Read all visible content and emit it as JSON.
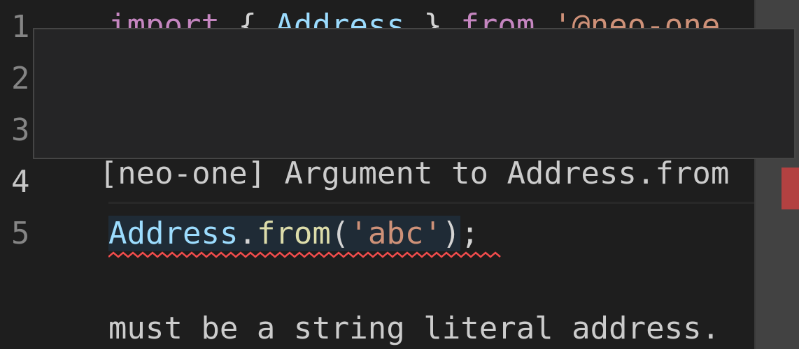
{
  "editor": {
    "line_numbers": [
      "1",
      "2",
      "3",
      "4",
      "5"
    ],
    "line1": {
      "kw_import": "import",
      "brace_open": " { ",
      "identifier": "Address",
      "brace_close": " } ",
      "kw_from": "from",
      "space": " ",
      "module": "'@neo-one"
    },
    "line5": {
      "object": "Address",
      "dot": ".",
      "method": "from",
      "paren_open": "(",
      "arg": "'abc'",
      "paren_close": ")",
      "semicolon": ";"
    }
  },
  "hover": {
    "line1": "[neo-one] Argument to Address.from",
    "line2": "must be a string literal address."
  },
  "colors": {
    "background": "#1e1e1e",
    "error": "#f14c4c",
    "keyword": "#c586c0",
    "type": "#9cdcfe",
    "string": "#ce9178",
    "function": "#dcdcaa"
  }
}
